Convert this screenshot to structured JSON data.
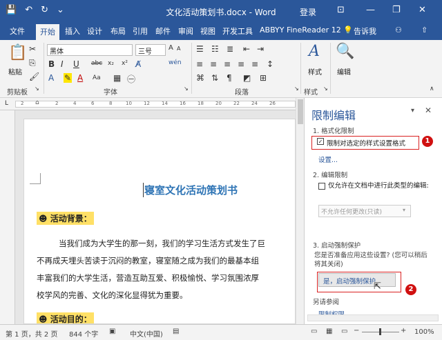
{
  "window": {
    "title": "文化活动策划书.docx - Word",
    "login": "登录",
    "min": "—",
    "restore": "❐",
    "close": "✕",
    "restore_ribbon": "⊡"
  },
  "tabs": [
    "文件",
    "开始",
    "插入",
    "设计",
    "布局",
    "引用",
    "邮件",
    "审阅",
    "视图",
    "开发工具",
    "ABBYY FineReader 12"
  ],
  "tell_me": "告诉我",
  "ribbon": {
    "paste": "粘贴",
    "font_name": "黑体",
    "font_size": "三号",
    "wen": "wén",
    "A": "A",
    "size_up": "A",
    "size_down": "A",
    "Aa": "Aa",
    "bold": "B",
    "italic": "I",
    "underline": "U",
    "strike": "abc",
    "sub": "x₂",
    "sup": "x²",
    "style": "样式",
    "edit": "编辑",
    "style_glyph": "A",
    "groups": {
      "clipboard": "剪贴板",
      "font": "字体",
      "paragraph": "段落",
      "styles": "样式"
    }
  },
  "ruler": {
    "corner": "L",
    "ticks": [
      "2",
      "2",
      "4",
      "6",
      "8",
      "10",
      "12",
      "14",
      "16",
      "18",
      "20",
      "22",
      "24",
      "26"
    ]
  },
  "document": {
    "title": "寝室文化活动策划书",
    "h1": "活动背景：",
    "p1": "当我们成为大学生的那一刻，我们的学习生活方式发生了巨",
    "p2": "不再成天埋头苦读于沉闷的教室，寝室随之成为我们的最基本组",
    "p3": "丰富我们的大学生活，营造互助互爱、积极愉悦、学习氛围浓厚",
    "p4": "校学风的完善、文化的深化显得犹为重要。",
    "h2": "活动目的："
  },
  "pane": {
    "title": "限制编辑",
    "s1": "1. 格式化限制",
    "s1_checkbox": "限制对选定的样式设置格式",
    "s1_link": "设置...",
    "s2": "2. 编辑限制",
    "s2_checkbox": "仅允许在文档中进行此类型的编辑:",
    "s2_select": "不允许任何更改(只读)",
    "s3": "3. 启动强制保护",
    "s3_text": "您是否准备应用这些设置? (您可以稍后将其关闭)",
    "s3_button": "是，启动强制保护",
    "see_also": "另请参阅",
    "link2": "限制权限..."
  },
  "badges": {
    "b1": "1",
    "b2": "2"
  },
  "status": {
    "page": "第 1 页，共 2 页",
    "words": "844 个字",
    "lang": "中文(中国)",
    "zoom": "100%"
  },
  "colors": {
    "accent": "#2b579a",
    "title_blue": "#2e74b5",
    "highlight": "#ffe066",
    "annotation_red": "#d92020"
  }
}
